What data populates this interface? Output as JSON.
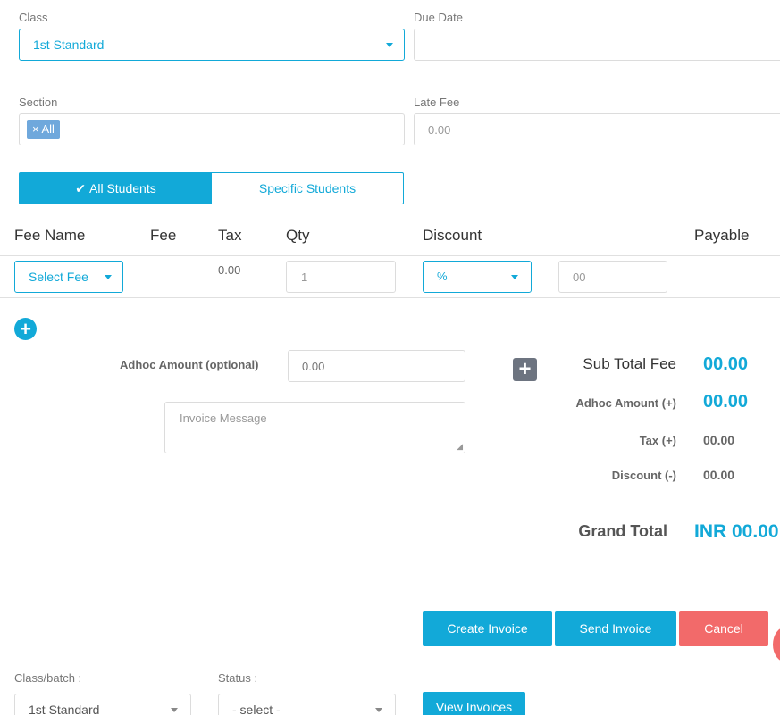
{
  "form": {
    "class_label": "Class",
    "class_value": "1st Standard",
    "due_date_label": "Due Date",
    "section_label": "Section",
    "section_tag": "All",
    "late_fee_label": "Late Fee",
    "late_fee_placeholder": "0.00",
    "toggle_all": "All Students",
    "toggle_specific": "Specific Students"
  },
  "table": {
    "headers": [
      "Fee Name",
      "Fee",
      "Tax",
      "Qty",
      "Discount",
      "Payable"
    ],
    "row": {
      "fee_select": "Select Fee",
      "tax": "0.00",
      "qty": "1",
      "discount_type": "%",
      "discount_placeholder": "00"
    }
  },
  "adhoc": {
    "label": "Adhoc Amount (optional)",
    "placeholder": "0.00",
    "message_placeholder": "Invoice Message"
  },
  "summary": {
    "sub_total_label": "Sub Total Fee",
    "sub_total_value": "00.00",
    "adhoc_label": "Adhoc Amount (+)",
    "adhoc_value": "00.00",
    "tax_label": "Tax (+)",
    "tax_value": "00.00",
    "discount_label": "Discount (-)",
    "discount_value": "00.00",
    "grand_total_label": "Grand Total",
    "grand_total_value": "INR 00.00"
  },
  "actions": {
    "create": "Create Invoice",
    "send": "Send Invoice",
    "cancel": "Cancel"
  },
  "filters": {
    "class_batch_label": "Class/batch :",
    "class_batch_value": "1st Standard",
    "status_label": "Status :",
    "status_value": "- select -",
    "view_button": "View Invoices"
  },
  "colors": {
    "accent": "#12a9d8",
    "cancel": "#f26a6a",
    "tag": "#6fa8dc"
  }
}
